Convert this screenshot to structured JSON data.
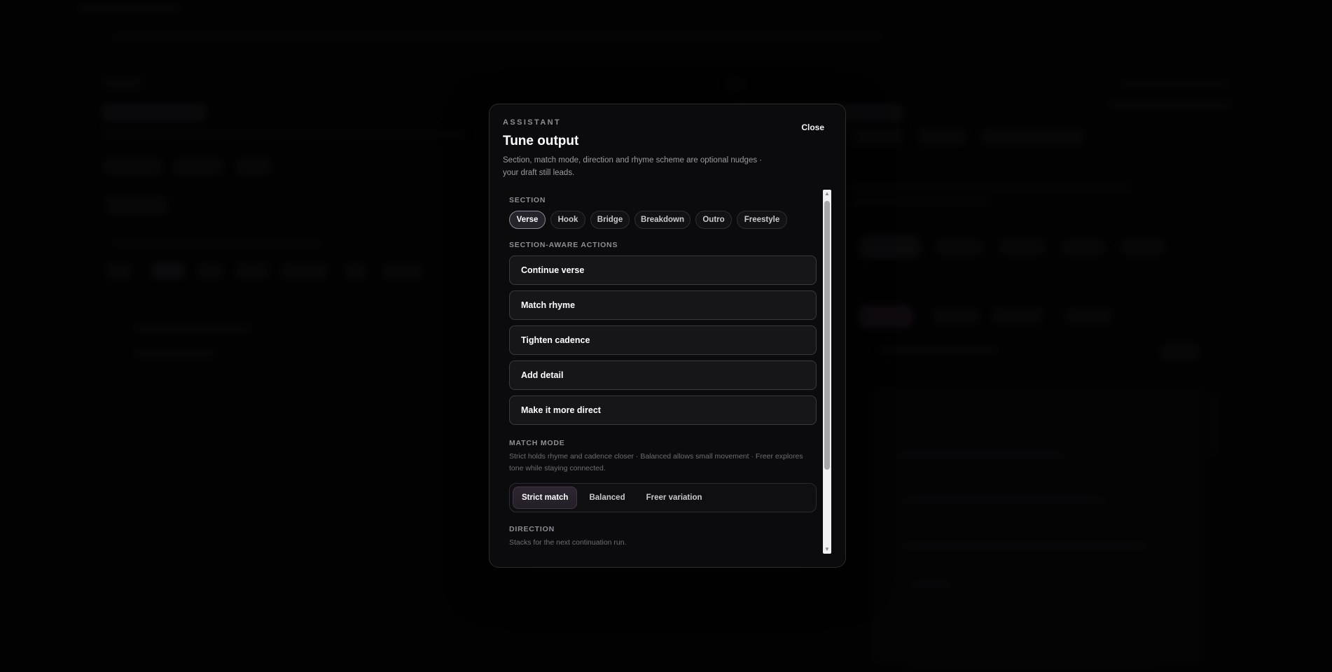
{
  "modal": {
    "eyebrow": "ASSISTANT",
    "title": "Tune output",
    "subtitle": "Section, match mode, direction and rhyme scheme are optional nudges · your draft still leads.",
    "close_label": "Close"
  },
  "section": {
    "label": "SECTION",
    "chips": [
      {
        "label": "Verse",
        "active": true
      },
      {
        "label": "Hook"
      },
      {
        "label": "Bridge"
      },
      {
        "label": "Breakdown"
      },
      {
        "label": "Outro"
      },
      {
        "label": "Freestyle"
      }
    ]
  },
  "section_actions": {
    "label": "SECTION-AWARE ACTIONS",
    "items": [
      {
        "label": "Continue verse"
      },
      {
        "label": "Match rhyme"
      },
      {
        "label": "Tighten cadence"
      },
      {
        "label": "Add detail"
      },
      {
        "label": "Make it more direct"
      }
    ]
  },
  "match_mode": {
    "label": "MATCH MODE",
    "help": "Strict holds rhyme and cadence closer · Balanced allows small movement · Freer explores tone while staying connected.",
    "options": [
      {
        "label": "Strict match",
        "active": true
      },
      {
        "label": "Balanced"
      },
      {
        "label": "Freer variation"
      }
    ]
  },
  "direction": {
    "label": "DIRECTION",
    "help": "Stacks for the next continuation run."
  },
  "colors": {
    "background": "#050506",
    "modal": "#0b0b0d",
    "accent_active": "#2e2530"
  },
  "icons": {
    "scroll_up": "scroll-up-arrow-icon",
    "scroll_down": "scroll-down-arrow-icon"
  }
}
